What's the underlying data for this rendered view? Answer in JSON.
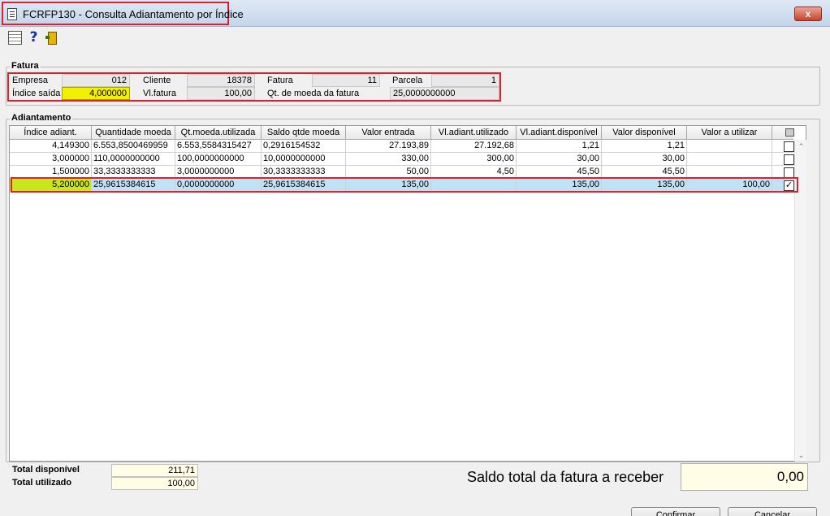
{
  "window": {
    "title": "FCRFP130 - Consulta Adiantamento por Índice",
    "close_label": "x"
  },
  "toolbar": {
    "help_label": "?"
  },
  "fatura": {
    "group_label": "Fatura",
    "empresa_label": "Empresa",
    "empresa_value": "012",
    "indice_saida_label": "Índice saída",
    "indice_saida_value": "4,000000",
    "cliente_label": "Cliente",
    "cliente_value": "18378",
    "vl_fatura_label": "Vl.fatura",
    "vl_fatura_value": "100,00",
    "fatura_label": "Fatura",
    "fatura_value": "11",
    "qt_moeda_label": "Qt. de moeda da fatura",
    "qt_moeda_value": "25,0000000000",
    "parcela_label": "Parcela",
    "parcela_value": "1"
  },
  "adiantamento": {
    "group_label": "Adiantamento",
    "columns": [
      "Índice adiant.",
      "Quantidade moeda",
      "Qt.moeda.utilizada",
      "Saldo qtde moeda",
      "Valor entrada",
      "Vl.adiant.utilizado",
      "Vl.adiant.disponível",
      "Valor disponível",
      "Valor a utilizar"
    ],
    "rows": [
      {
        "cells": [
          "4,149300",
          "6.553,8500469959",
          "6.553,5584315427",
          "0,2916154532",
          "27.193,89",
          "27.192,68",
          "1,21",
          "1,21",
          ""
        ],
        "checked": ""
      },
      {
        "cells": [
          "3,000000",
          "110,0000000000",
          "100,0000000000",
          "10,0000000000",
          "330,00",
          "300,00",
          "30,00",
          "30,00",
          ""
        ],
        "checked": ""
      },
      {
        "cells": [
          "1,500000",
          "33,3333333333",
          "3,0000000000",
          "30,3333333333",
          "50,00",
          "4,50",
          "45,50",
          "45,50",
          ""
        ],
        "checked": ""
      },
      {
        "cells": [
          "5,200000",
          "25,9615384615",
          "0,0000000000",
          "25,9615384615",
          "135,00",
          "",
          "135,00",
          "135,00",
          "100,00"
        ],
        "checked": "✓"
      }
    ]
  },
  "totals": {
    "disponivel_label": "Total disponível",
    "disponivel_value": "211,71",
    "utilizado_label": "Total utilizado",
    "utilizado_value": "100,00",
    "saldo_label": "Saldo total da fatura a receber",
    "saldo_value": "0,00"
  },
  "buttons": {
    "confirmar": "Confirmar",
    "cancelar": "Cancelar"
  }
}
